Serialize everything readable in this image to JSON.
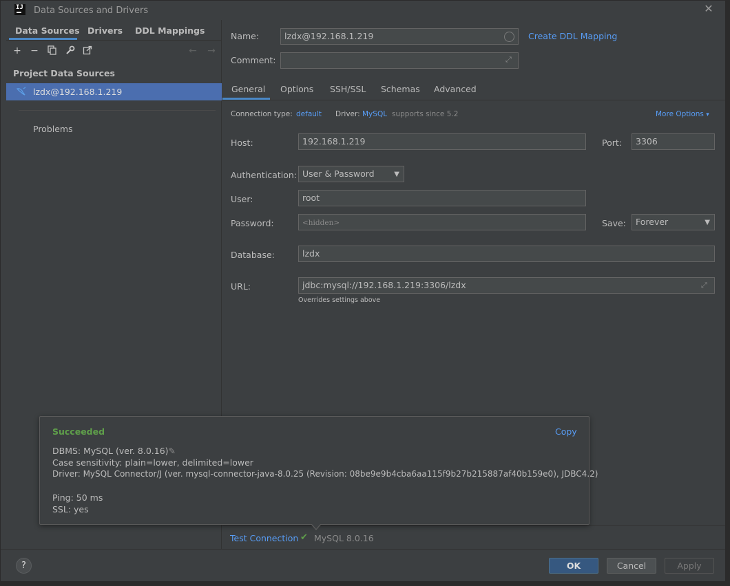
{
  "window": {
    "title": "Data Sources and Drivers",
    "logo_text": "IJ"
  },
  "left": {
    "tabs": [
      "Data Sources",
      "Drivers",
      "DDL Mappings"
    ],
    "section_title": "Project Data Sources",
    "datasource": "lzdx@192.168.1.219",
    "problems": "Problems"
  },
  "form": {
    "name_label": "Name:",
    "name_value": "lzdx@192.168.1.219",
    "create_ddl_link": "Create DDL Mapping",
    "comment_label": "Comment:",
    "comment_value": "",
    "tabs": [
      "General",
      "Options",
      "SSH/SSL",
      "Schemas",
      "Advanced"
    ],
    "connection_type_label": "Connection type:",
    "connection_type_value": "default",
    "driver_label": "Driver:",
    "driver_value": "MySQL",
    "driver_note": "supports since 5.2",
    "more_options": "More Options",
    "host_label": "Host:",
    "host_value": "192.168.1.219",
    "port_label": "Port:",
    "port_value": "3306",
    "auth_label": "Authentication:",
    "auth_value": "User & Password",
    "user_label": "User:",
    "user_value": "root",
    "password_label": "Password:",
    "password_placeholder": "<hidden>",
    "save_label": "Save:",
    "save_value": "Forever",
    "database_label": "Database:",
    "database_value": "lzdx",
    "url_label": "URL:",
    "url_value": "jdbc:mysql://192.168.1.219:3306/lzdx",
    "url_note": "Overrides settings above"
  },
  "popup": {
    "status": "Succeeded",
    "copy": "Copy",
    "dbms": "DBMS: MySQL (ver. 8.0.16)",
    "case_sensitivity": "Case sensitivity: plain=lower, delimited=lower",
    "driver": "Driver: MySQL Connector/J (ver. mysql-connector-java-8.0.25 (Revision: 08be9e9b4cba6aa115f9b27b215887af40b159e0), JDBC4.2)",
    "ping": "Ping: 50 ms",
    "ssl": "SSL: yes"
  },
  "test": {
    "link": "Test Connection",
    "result": "MySQL 8.0.16"
  },
  "buttons": {
    "help": "?",
    "ok": "OK",
    "cancel": "Cancel",
    "apply": "Apply"
  },
  "colors": {
    "accent": "#4a88c7",
    "link": "#589df6",
    "success": "#5f9f4a",
    "selection": "#4b6eaf",
    "primary_button": "#365880"
  }
}
